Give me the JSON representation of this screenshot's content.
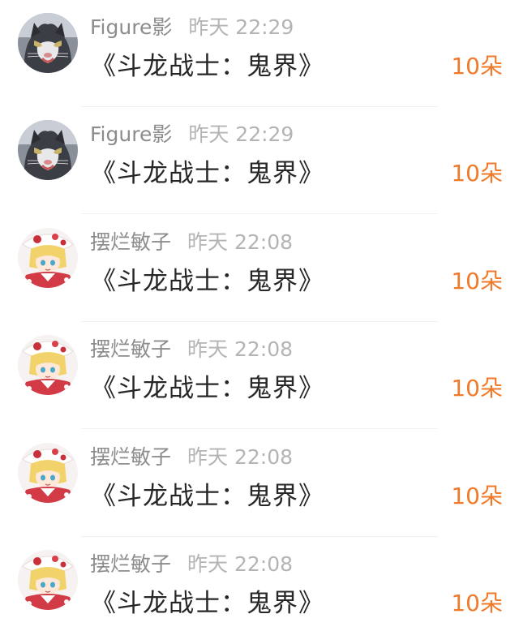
{
  "gift_list": {
    "colors": {
      "username": "#8c8c8c",
      "timestamp": "#b4b4b4",
      "gift_name": "#262626",
      "gift_count": "#f07a2a",
      "divider": "#f0f0f0"
    },
    "items": [
      {
        "avatar": "cat-avatar",
        "username": "Figure影",
        "timestamp": "昨天 22:29",
        "gift_name": "《斗龙战士：鬼界》",
        "gift_count": "10朵"
      },
      {
        "avatar": "cat-avatar",
        "username": "Figure影",
        "timestamp": "昨天 22:29",
        "gift_name": "《斗龙战士：鬼界》",
        "gift_count": "10朵"
      },
      {
        "avatar": "anime-girl-avatar",
        "username": "摆烂敏子",
        "timestamp": "昨天 22:08",
        "gift_name": "《斗龙战士：鬼界》",
        "gift_count": "10朵"
      },
      {
        "avatar": "anime-girl-avatar",
        "username": "摆烂敏子",
        "timestamp": "昨天 22:08",
        "gift_name": "《斗龙战士：鬼界》",
        "gift_count": "10朵"
      },
      {
        "avatar": "anime-girl-avatar",
        "username": "摆烂敏子",
        "timestamp": "昨天 22:08",
        "gift_name": "《斗龙战士：鬼界》",
        "gift_count": "10朵"
      },
      {
        "avatar": "anime-girl-avatar",
        "username": "摆烂敏子",
        "timestamp": "昨天 22:08",
        "gift_name": "《斗龙战士：鬼界》",
        "gift_count": "10朵"
      }
    ]
  }
}
